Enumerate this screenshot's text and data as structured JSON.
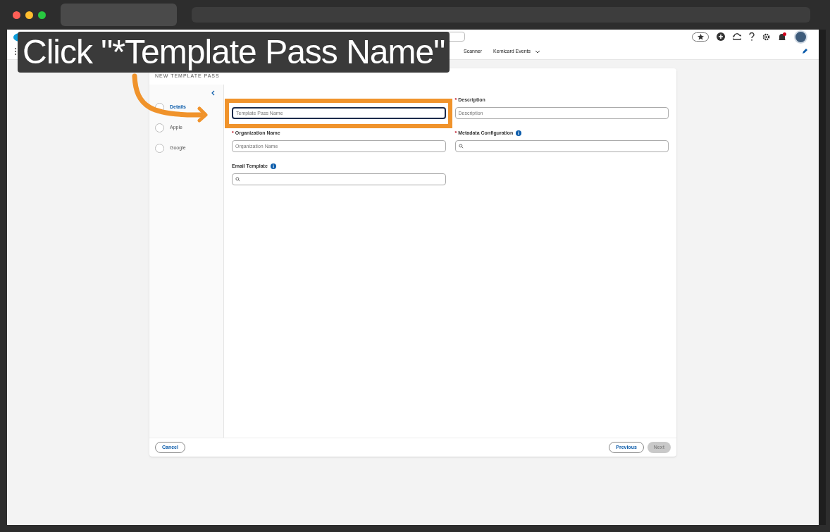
{
  "header": {
    "nav_items": [
      {
        "label": "Scanner",
        "kind": "plain"
      },
      {
        "label": "Kemicard Events",
        "kind": "menu"
      }
    ]
  },
  "dialog": {
    "title": "NEW TEMPLATE PASS",
    "steps": [
      {
        "label": "Details",
        "selected": true
      },
      {
        "label": "Apple",
        "selected": false
      },
      {
        "label": "Google",
        "selected": false
      }
    ],
    "fields": [
      {
        "kind": "text",
        "placeholder": "Template Pass Name",
        "focused": true
      },
      {
        "kind": "text",
        "required_mark": "*",
        "label": "Description",
        "placeholder": "Description",
        "focused": false
      },
      {
        "kind": "text",
        "required_mark": "*",
        "label": "Organization Name",
        "placeholder": "Organization Name",
        "focused": false
      },
      {
        "kind": "lookup",
        "required_mark": "*",
        "label": "Metadata Configuration",
        "info": true,
        "focused": false
      },
      {
        "kind": "lookup",
        "label": "Email Template",
        "info": true,
        "focused": false
      }
    ],
    "buttons": [
      {
        "label": "Cancel",
        "kind": "cancel",
        "disabled": false
      },
      {
        "label": "Previous",
        "kind": "secondary",
        "disabled": false
      },
      {
        "label": "Next",
        "kind": "primary",
        "disabled": true
      }
    ]
  },
  "callout": {
    "text": "Click \"*Template Pass Name\""
  }
}
